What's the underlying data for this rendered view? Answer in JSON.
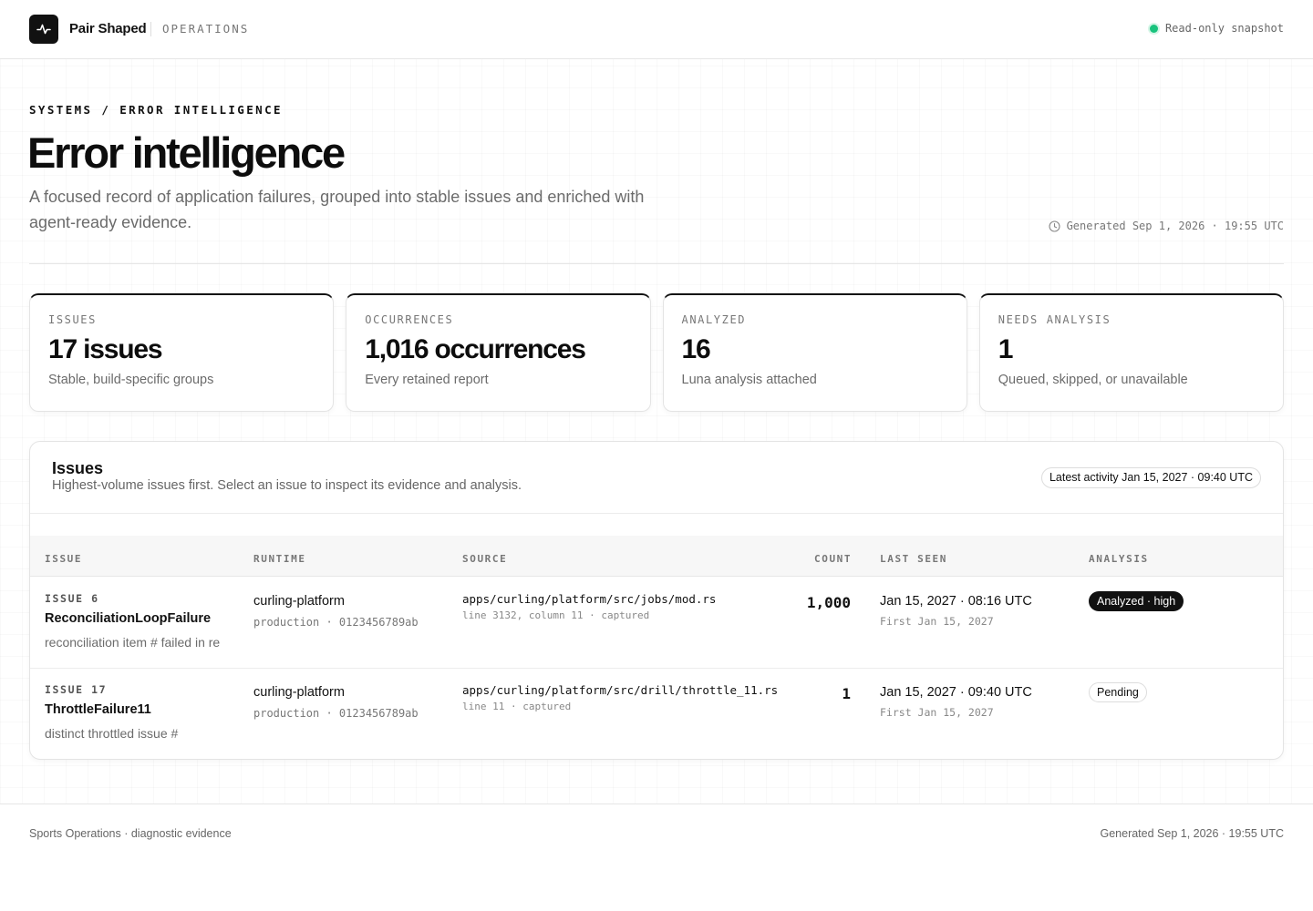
{
  "topbar": {
    "brand_name": "Pair Shaped",
    "section": "OPERATIONS",
    "snapshot_label": "Read-only snapshot"
  },
  "hero": {
    "breadcrumb": "SYSTEMS / ERROR INTELLIGENCE",
    "title": "Error intelligence",
    "description": "A focused record of application failures, grouped into stable issues and enriched with agent-ready evidence.",
    "generated": "Generated Sep 1, 2026 · 19:55 UTC"
  },
  "stats": [
    {
      "label": "ISSUES",
      "value": "17 issues",
      "sub": "Stable, build-specific groups"
    },
    {
      "label": "OCCURRENCES",
      "value": "1,016 occurrences",
      "sub": "Every retained report"
    },
    {
      "label": "ANALYZED",
      "value": "16",
      "sub": "Luna analysis attached"
    },
    {
      "label": "NEEDS ANALYSIS",
      "value": "1",
      "sub": "Queued, skipped, or unavailable"
    }
  ],
  "issues": {
    "title": "Issues",
    "description": "Highest-volume issues first. Select an issue to inspect its evidence and analysis.",
    "latest_activity": "Latest activity Jan 15, 2027 · 09:40 UTC",
    "columns": {
      "issue": "ISSUE",
      "runtime": "RUNTIME",
      "source": "SOURCE",
      "count": "COUNT",
      "last_seen": "LAST SEEN",
      "analysis": "ANALYSIS"
    },
    "rows": [
      {
        "number": "ISSUE 6",
        "name": "ReconciliationLoopFailure",
        "message": "reconciliation item # failed in re",
        "runtime": "curling-platform",
        "runtime_meta": "production · 0123456789ab",
        "source_path": "apps/curling/platform/src/jobs/mod.rs",
        "source_meta": "line 3132, column 11 · captured",
        "count": "1,000",
        "last_seen": "Jan 15, 2027 · 08:16 UTC",
        "first_seen": "First Jan 15, 2027",
        "analysis": "Analyzed · high"
      },
      {
        "number": "ISSUE 17",
        "name": "ThrottleFailure11",
        "message": "distinct throttled issue #",
        "runtime": "curling-platform",
        "runtime_meta": "production · 0123456789ab",
        "source_path": "apps/curling/platform/src/drill/throttle_11.rs",
        "source_meta": "line 11 · captured",
        "count": "1",
        "last_seen": "Jan 15, 2027 · 09:40 UTC",
        "first_seen": "First Jan 15, 2027",
        "analysis": "Pending"
      }
    ]
  },
  "footer": {
    "left": "Sports Operations · diagnostic evidence",
    "right": "Generated Sep 1, 2026 · 19:55 UTC"
  },
  "icons": {
    "brand": "pulse-icon",
    "status": "status-dot-icon",
    "generated": "clock-icon"
  },
  "colors": {
    "accent": "#111111",
    "status_ok": "#19c37d"
  }
}
